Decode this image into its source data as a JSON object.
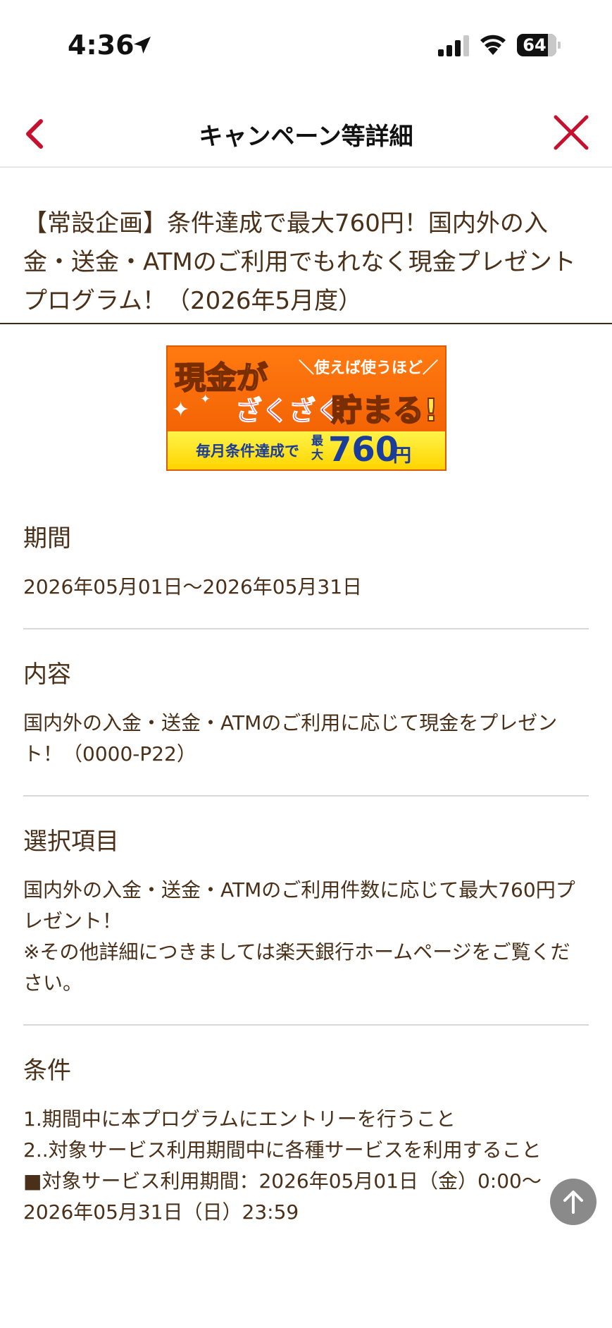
{
  "status_bar": {
    "time": "4:36",
    "battery": "64"
  },
  "nav": {
    "title": "キャンペーン等詳細",
    "accent_color": "#c8102e"
  },
  "page": {
    "title": "【常設企画】条件達成で最大760円！国内外の入金・送金・ATMのご利用でもれなく現金プレゼントプログラム！（2026年5月度）"
  },
  "banner": {
    "headline1": "現金が",
    "tag": "＼使えば使うほど／",
    "headline2a": "ざくざく",
    "headline2b": "貯まる!",
    "subtext": "毎月条件達成で",
    "max_label": "最大",
    "amount": "760",
    "unit": "円"
  },
  "sections": [
    {
      "heading": "期間",
      "body": "2026年05月01日〜2026年05月31日"
    },
    {
      "heading": "内容",
      "body": "国内外の入金・送金・ATMのご利用に応じて現金をプレゼント！（0000-P22）"
    },
    {
      "heading": "選択項目",
      "body": "国内外の入金・送金・ATMのご利用件数に応じて最大760円プレゼント！\n※その他詳細につきましては楽天銀行ホームページをご覧ください。"
    },
    {
      "heading": "条件",
      "body": "1.期間中に本プログラムにエントリーを行うこと\n2..対象サービス利用期間中に各種サービスを利用すること\n■対象サービス利用期間：2026年05月01日（金）0:00〜2026年05月31日（日）23:59"
    }
  ]
}
